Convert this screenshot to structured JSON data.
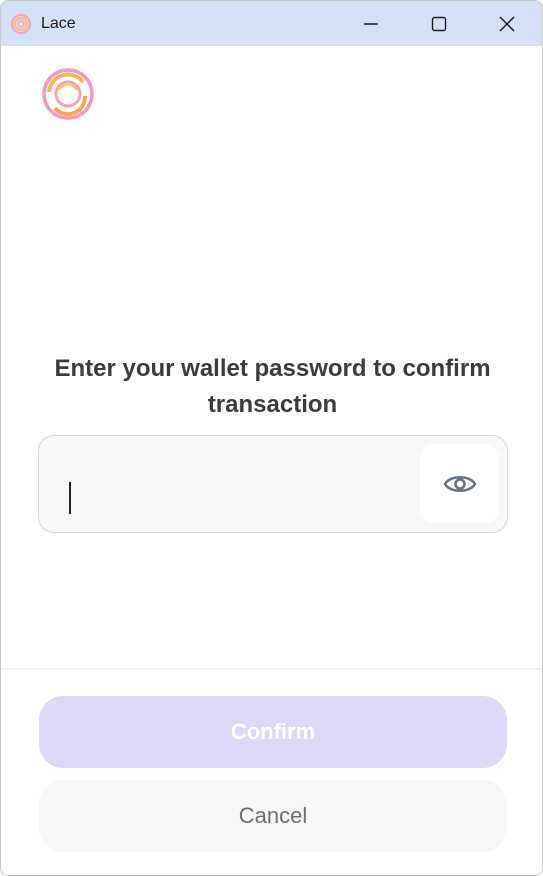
{
  "window": {
    "title": "Lace",
    "controls": {
      "minimize": "minimize",
      "maximize": "maximize",
      "close": "close"
    }
  },
  "colors": {
    "titlebar": "#d3e1f7",
    "confirm_bg": "#ded8f6",
    "cancel_bg": "#f7f7f7",
    "field_border": "#d4d2f0"
  },
  "icons": {
    "app": "lace-logo-icon",
    "eye": "eye-icon"
  },
  "main": {
    "heading": "Enter your wallet password to confirm transaction",
    "password": {
      "value": "",
      "placeholder": ""
    }
  },
  "actions": {
    "confirm_label": "Confirm",
    "cancel_label": "Cancel"
  }
}
